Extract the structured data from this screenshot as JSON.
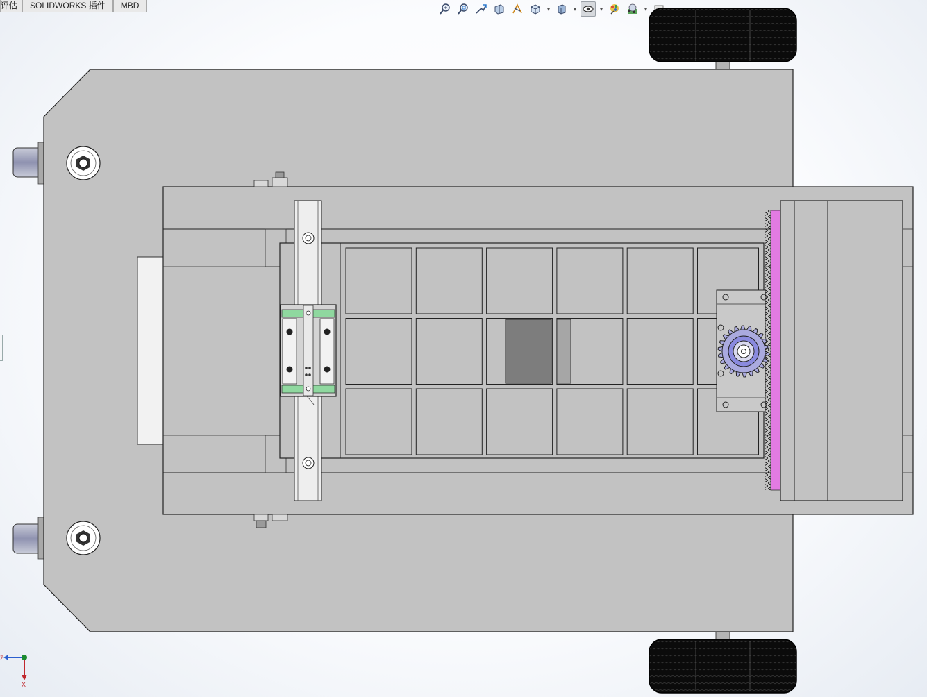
{
  "tabs": [
    {
      "label": "评估"
    },
    {
      "label": "SOLIDWORKS 插件"
    },
    {
      "label": "MBD"
    }
  ],
  "view_toolbar": {
    "icons": [
      "zoom-to-fit-icon",
      "zoom-to-area-icon",
      "previous-view-icon",
      "section-view-icon",
      "dynamic-annotation-icon",
      "view-orientation-icon",
      "display-style-icon",
      "hide-show-items-icon",
      "edit-appearance-icon",
      "apply-scene-icon",
      "view-settings-icon"
    ]
  },
  "triad": {
    "z_label": "Z",
    "x_label": "X"
  },
  "colors": {
    "plate": "#c2c2c2",
    "rack": "#e27be2",
    "rail_block_accent": "#8fd89f",
    "gear": "#8a8adf",
    "wheel": "#0a0a0a",
    "triad_x": "#c0282d",
    "triad_z": "#2c5fcf",
    "triad_y": "#1b8a2f"
  }
}
